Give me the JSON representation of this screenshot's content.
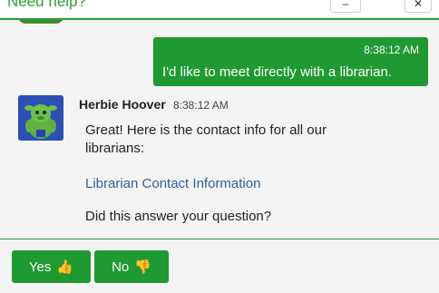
{
  "header": {
    "title": "Need help?",
    "minimize_icon": "minimize-icon",
    "close_icon": "close-icon"
  },
  "messages": {
    "user": {
      "time": "8:38:12 AM",
      "text": "I'd like to meet directly with a librarian."
    },
    "bot": {
      "name": "Herbie Hoover",
      "time": "8:38:12 AM",
      "text": "Great! Here is the contact info for all our librarians:",
      "link_text": "Librarian Contact Information",
      "question": "Did this answer your question?"
    }
  },
  "quick_replies": {
    "yes_label": "Yes",
    "yes_icon": "thumbs-up-icon",
    "no_label": "No",
    "no_icon": "thumbs-down-icon"
  },
  "colors": {
    "accent_green": "#1f9a32",
    "link_blue": "#2c5f99",
    "thumb_yellow": "#f6b500"
  }
}
